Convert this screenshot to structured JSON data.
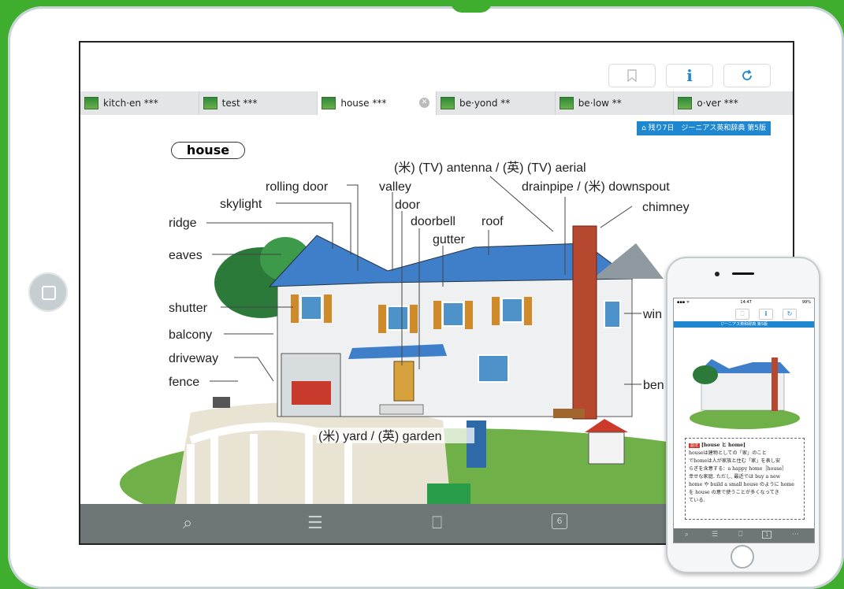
{
  "tabs": [
    {
      "label": "kitch·en ***",
      "active": false
    },
    {
      "label": "test ***",
      "active": false
    },
    {
      "label": "house ***",
      "active": true
    },
    {
      "label": "be·yond **",
      "active": false
    },
    {
      "label": "be·low **",
      "active": false
    },
    {
      "label": "o·ver ***",
      "active": false
    }
  ],
  "toolbar": {
    "bookmark_icon": "bookmark-icon",
    "info_label": "i",
    "refresh_icon": "refresh-icon"
  },
  "dictionary_badge": "残り7日　ジーニアス英和辞典 第5版",
  "headword": "house",
  "labels": {
    "antenna": "(米) (TV) antenna / (英) (TV) aerial",
    "rolling_door": "rolling door",
    "valley": "valley",
    "drainpipe": "drainpipe / (米) downspout",
    "skylight": "skylight",
    "door": "door",
    "chimney": "chimney",
    "ridge": "ridge",
    "doorbell": "doorbell",
    "roof": "roof",
    "gutter": "gutter",
    "eaves": "eaves",
    "shutter": "shutter",
    "window": "win",
    "balcony": "balcony",
    "driveway": "driveway",
    "fence": "fence",
    "bench": "ben",
    "yard": "(米) yard / (英) garden"
  },
  "bottom_bar": {
    "page_count": "6"
  },
  "phone": {
    "time": "14:47",
    "battery": "99%",
    "dictionary_band": "ジーニアス英和辞典 第5版",
    "note_tag": "語法",
    "note_title": "[house と home]",
    "note_lines": [
      "houseは建物としての「家」のこと",
      "でhomeは人が家族と住む「家」を表し安",
      "らぎを含意する：a happy home［house］",
      "幸せな家庭. ただし, 最近では buy a new",
      "home や build a small house のように home",
      "を house の意で使うことが多くなってき",
      "ている."
    ],
    "page_count": "1"
  }
}
